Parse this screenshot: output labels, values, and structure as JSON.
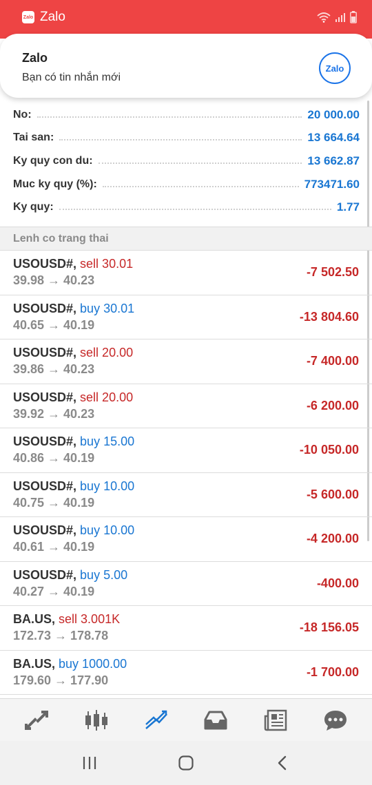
{
  "status_bar": {
    "app_name": "Zalo",
    "app_icon": "zalo-app-icon"
  },
  "notification": {
    "title": "Zalo",
    "message": "Bạn có tin nhắn mới",
    "logo_text": "Zalo"
  },
  "account": {
    "rows": [
      {
        "label": "No:",
        "value": "20 000.00"
      },
      {
        "label": "Tai san:",
        "value": "13 664.64"
      },
      {
        "label": "Ky quy con du:",
        "value": "13 662.87"
      },
      {
        "label": "Muc ky quy (%):",
        "value": "773471.60"
      },
      {
        "label": "Ky quy:",
        "value": "1.77"
      }
    ]
  },
  "section": {
    "title": "Lenh co trang thai"
  },
  "orders": [
    {
      "symbol": "USOUSD#,",
      "side": "sell 30.01",
      "side_type": "sell",
      "prices": "39.98 → 40.23",
      "profit": "-7 502.50"
    },
    {
      "symbol": "USOUSD#,",
      "side": "buy 30.01",
      "side_type": "buy",
      "prices": "40.65 → 40.19",
      "profit": "-13 804.60"
    },
    {
      "symbol": "USOUSD#,",
      "side": "sell 20.00",
      "side_type": "sell",
      "prices": "39.86 → 40.23",
      "profit": "-7 400.00"
    },
    {
      "symbol": "USOUSD#,",
      "side": "sell 20.00",
      "side_type": "sell",
      "prices": "39.92 → 40.23",
      "profit": "-6 200.00"
    },
    {
      "symbol": "USOUSD#,",
      "side": "buy 15.00",
      "side_type": "buy",
      "prices": "40.86 → 40.19",
      "profit": "-10 050.00"
    },
    {
      "symbol": "USOUSD#,",
      "side": "buy 10.00",
      "side_type": "buy",
      "prices": "40.75 → 40.19",
      "profit": "-5 600.00"
    },
    {
      "symbol": "USOUSD#,",
      "side": "buy 10.00",
      "side_type": "buy",
      "prices": "40.61 → 40.19",
      "profit": "-4 200.00"
    },
    {
      "symbol": "USOUSD#,",
      "side": "buy 5.00",
      "side_type": "buy",
      "prices": "40.27 → 40.19",
      "profit": "-400.00"
    },
    {
      "symbol": "BA.US,",
      "side": "sell 3.001K",
      "side_type": "sell",
      "prices": "172.73 → 178.78",
      "profit": "-18 156.05"
    },
    {
      "symbol": "BA.US,",
      "side": "buy 1000.00",
      "side_type": "buy",
      "prices": "179.60 → 177.90",
      "profit": "-1 700.00"
    }
  ],
  "toolbar": {
    "items": [
      {
        "icon": "quotes-arrows-icon",
        "active": false
      },
      {
        "icon": "candlestick-chart-icon",
        "active": false
      },
      {
        "icon": "trade-icon",
        "active": true
      },
      {
        "icon": "inbox-icon",
        "active": false
      },
      {
        "icon": "news-icon",
        "active": false
      },
      {
        "icon": "chat-icon",
        "active": false
      }
    ]
  },
  "nav": {
    "items": [
      "recent-apps-icon",
      "home-icon",
      "back-icon"
    ]
  },
  "colors": {
    "status_bar": "#ee4444",
    "value_blue": "#1976d2",
    "loss_red": "#c62828",
    "label_gray": "#8a8a8a"
  }
}
